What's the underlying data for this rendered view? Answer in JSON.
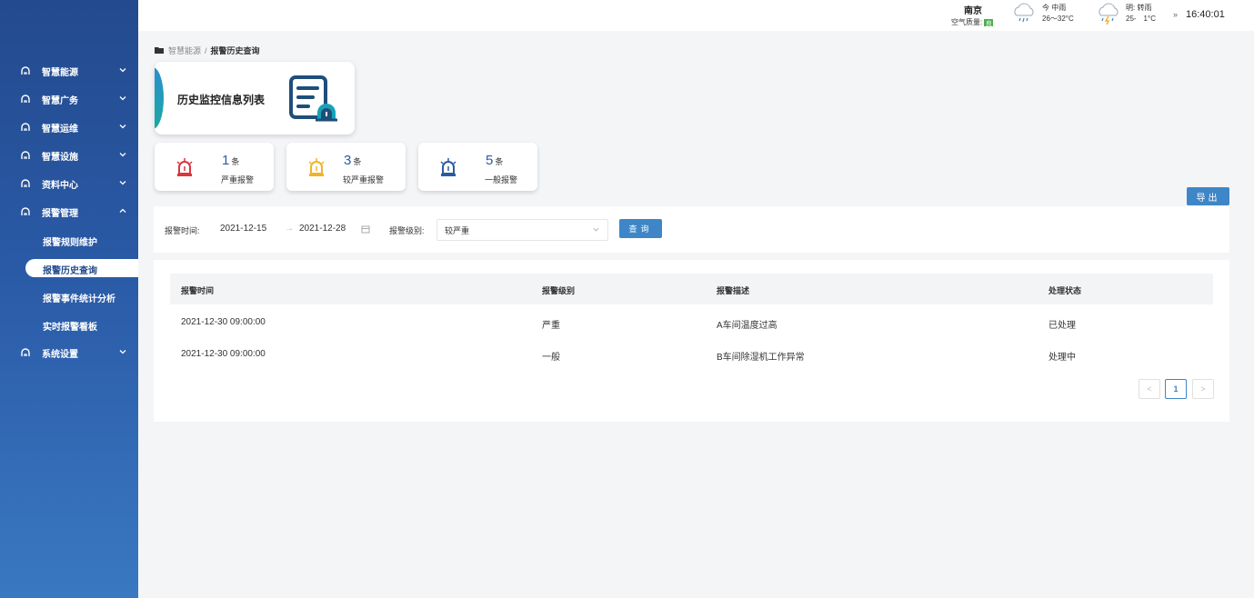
{
  "sidebar": {
    "items": [
      {
        "label": "智慧能源"
      },
      {
        "label": "智慧广务"
      },
      {
        "label": "智慧运维"
      },
      {
        "label": "智慧设施"
      },
      {
        "label": "资料中心"
      },
      {
        "label": "报警管理"
      },
      {
        "label": "系统设置"
      }
    ],
    "sub_items": [
      {
        "label": "报警规则维护"
      },
      {
        "label": "报警历史查询"
      },
      {
        "label": "报警事件统计分析"
      },
      {
        "label": "实时报警看板"
      }
    ]
  },
  "header": {
    "city": "南京",
    "air_quality_label": "空气质量:",
    "air_quality_badge": "良",
    "today": {
      "day": "今 中雨",
      "temp": "26～32°C"
    },
    "tomorrow": {
      "day": "明: 转雨",
      "temp": "25-　1°C"
    },
    "time": "16:40:01"
  },
  "breadcrumb": {
    "parent": "智慧能源",
    "sep": "/",
    "current": "报警历史查询"
  },
  "title_card": {
    "title": "历史监控信息列表"
  },
  "stats": [
    {
      "count": "1",
      "unit": "条",
      "label": "严重报警",
      "color": "#d9363e"
    },
    {
      "count": "3",
      "unit": "条",
      "label": "较严重报警",
      "color": "#f0b429"
    },
    {
      "count": "5",
      "unit": "条",
      "label": "一般报警",
      "color": "#2a5aa6"
    }
  ],
  "export_label": "导出",
  "filter": {
    "time_label": "报警时间:",
    "start_date": "2021-12-15",
    "arrow": "→",
    "end_date": "2021-12-28",
    "level_label": "报警级别:",
    "level_value": "较严重",
    "query_label": "查询"
  },
  "table": {
    "columns": [
      "报警时间",
      "报警级别",
      "报警描述",
      "处理状态"
    ],
    "rows": [
      {
        "time": "2021-12-30 09:00:00",
        "level": "严重",
        "desc": "A车间温度过高",
        "status": "已处理"
      },
      {
        "time": "2021-12-30 09:00:00",
        "level": "一般",
        "desc": "B车间除湿机工作异常",
        "status": "处理中"
      }
    ]
  },
  "pagination": {
    "prev": "<",
    "current": "1",
    "next": ">"
  },
  "colors": {
    "accent": "#3e86c8",
    "sidebar": "#2a5aa6"
  }
}
